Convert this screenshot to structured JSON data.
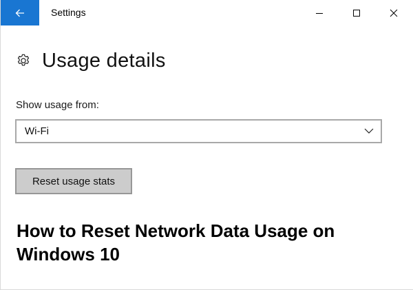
{
  "titlebar": {
    "title": "Settings",
    "back_icon": "back-arrow-icon",
    "controls": [
      "minimize-icon",
      "maximize-icon",
      "close-icon"
    ],
    "accent_color": "#1976d2"
  },
  "page": {
    "icon": "gear-icon",
    "title": "Usage details"
  },
  "usage": {
    "show_from_label": "Show usage from:",
    "selected_source": "Wi-Fi"
  },
  "actions": {
    "reset_label": "Reset usage stats"
  },
  "caption": {
    "text": "How to Reset Network Data Usage on Windows 10"
  }
}
